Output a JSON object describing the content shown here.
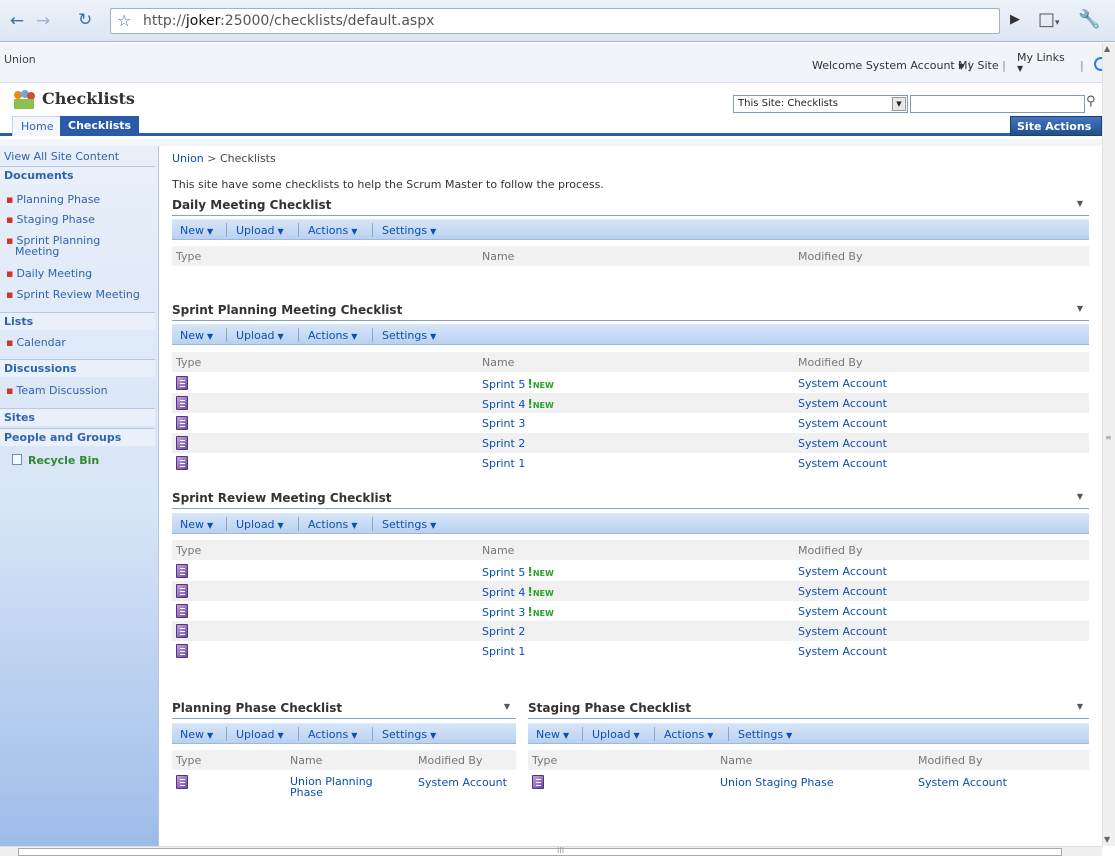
{
  "browser": {
    "url_prefix": "http://",
    "url_host": "joker",
    "url_rest": ":25000/checklists/default.aspx"
  },
  "header": {
    "top_site": "Union",
    "welcome": "Welcome System Account",
    "my_site": "My Site",
    "my_links": "My Links",
    "site_title": "Checklists",
    "search_scope": "This Site: Checklists",
    "site_actions": "Site Actions"
  },
  "tabs": [
    {
      "label": "Home"
    },
    {
      "label": "Checklists"
    }
  ],
  "nav": {
    "view_all": "View All Site Content",
    "documents": "Documents",
    "doc_items": [
      "Planning Phase",
      "Staging Phase",
      "Sprint Planning",
      "Meeting",
      "Daily Meeting",
      "Sprint Review Meeting"
    ],
    "lists": "Lists",
    "list_items": [
      "Calendar"
    ],
    "discussions": "Discussions",
    "discussion_items": [
      "Team Discussion"
    ],
    "sites": "Sites",
    "people": "People and Groups",
    "recycle_bin": "Recycle Bin"
  },
  "main": {
    "breadcrumb_root": "Union",
    "breadcrumb_sep": ">",
    "breadcrumb_current": "Checklists",
    "description": "This site have some checklists to help the Scrum Master to follow the process.",
    "toolbar": {
      "new": "New",
      "upload": "Upload",
      "actions": "Actions",
      "settings": "Settings"
    },
    "columns": {
      "type": "Type",
      "name": "Name",
      "modified_by": "Modified By"
    },
    "new_label": "NEW",
    "daily": {
      "title": "Daily Meeting Checklist"
    },
    "sprint_planning": {
      "title": "Sprint Planning Meeting Checklist",
      "rows": [
        {
          "name": "Sprint 5",
          "new": true,
          "modified_by": "System Account"
        },
        {
          "name": "Sprint 4",
          "new": true,
          "modified_by": "System Account"
        },
        {
          "name": "Sprint 3",
          "new": false,
          "modified_by": "System Account"
        },
        {
          "name": "Sprint 2",
          "new": false,
          "modified_by": "System Account"
        },
        {
          "name": "Sprint 1",
          "new": false,
          "modified_by": "System Account"
        }
      ]
    },
    "sprint_review": {
      "title": "Sprint Review Meeting Checklist",
      "rows": [
        {
          "name": "Sprint 5",
          "new": true,
          "modified_by": "System Account"
        },
        {
          "name": "Sprint 4",
          "new": true,
          "modified_by": "System Account"
        },
        {
          "name": "Sprint 3",
          "new": true,
          "modified_by": "System Account"
        },
        {
          "name": "Sprint 2",
          "new": false,
          "modified_by": "System Account"
        },
        {
          "name": "Sprint 1",
          "new": false,
          "modified_by": "System Account"
        }
      ]
    },
    "planning_phase": {
      "title": "Planning Phase Checklist",
      "row": {
        "name_line1": "Union Planning",
        "name_line2": "Phase",
        "modified_by": "System Account"
      }
    },
    "staging_phase": {
      "title": "Staging Phase Checklist",
      "row": {
        "name": "Union Staging Phase",
        "modified_by": "System Account"
      }
    }
  }
}
